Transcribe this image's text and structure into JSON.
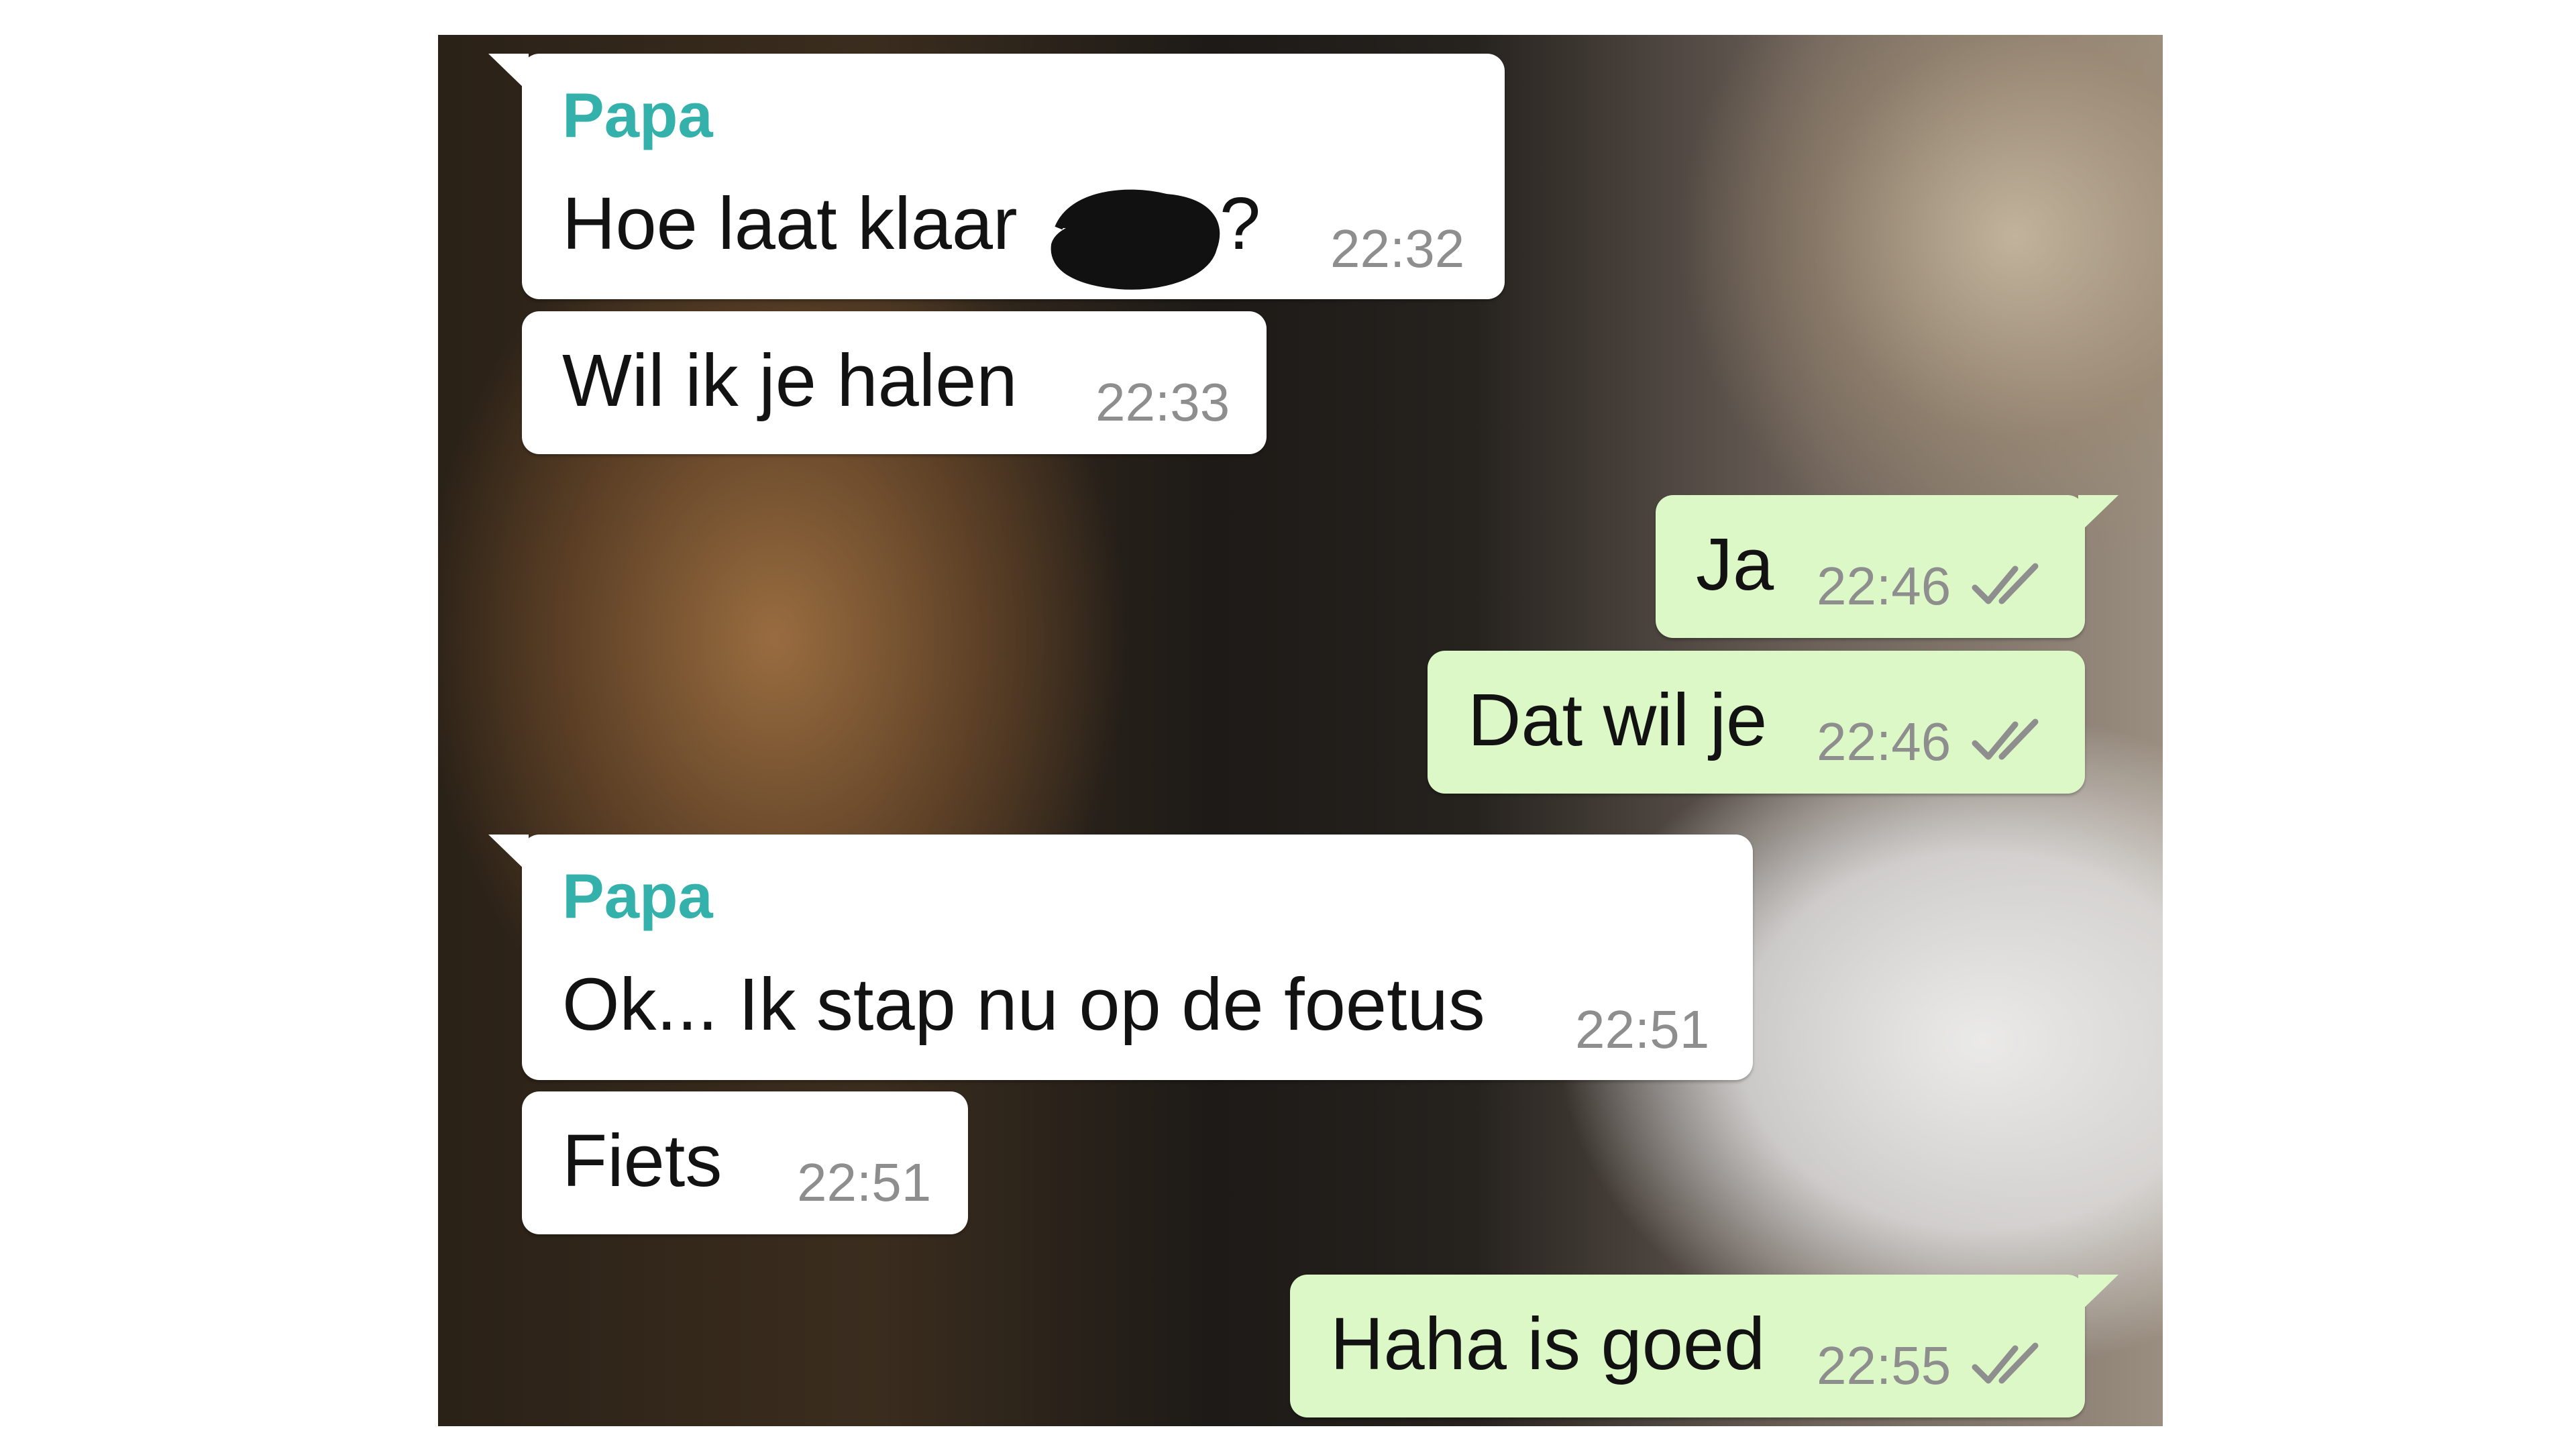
{
  "chat": {
    "messages": [
      {
        "direction": "incoming",
        "sender": "Papa",
        "text": "Hoe laat klaar",
        "text_suffix": "?",
        "time": "22:32",
        "redacted": true
      },
      {
        "direction": "incoming",
        "text": "Wil ik je halen",
        "time": "22:33"
      },
      {
        "direction": "outgoing",
        "text": "Ja",
        "time": "22:46",
        "status_icon": "double-check-icon"
      },
      {
        "direction": "outgoing",
        "text": "Dat wil je",
        "time": "22:46",
        "status_icon": "double-check-icon"
      },
      {
        "direction": "incoming",
        "sender": "Papa",
        "text": "Ok... Ik stap nu op de foetus",
        "time": "22:51"
      },
      {
        "direction": "incoming",
        "text": "Fiets",
        "time": "22:51"
      },
      {
        "direction": "outgoing",
        "text": "Haha is goed",
        "time": "22:55",
        "status_icon": "double-check-icon"
      }
    ]
  },
  "colors": {
    "incoming_bubble": "#ffffff",
    "outgoing_bubble": "#dcf8c6",
    "sender_name": "#35b1ac",
    "timestamp": "#8e8e8e",
    "read_ticks": "#8e8e8e"
  }
}
